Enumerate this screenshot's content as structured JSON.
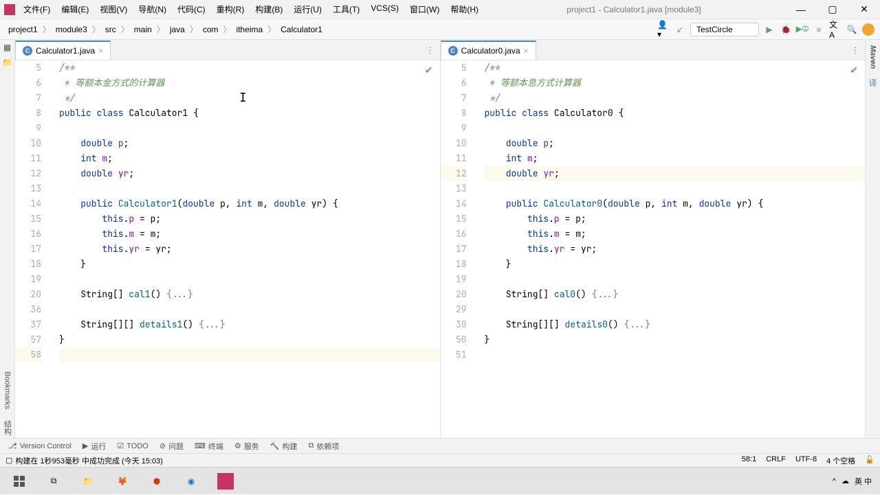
{
  "window": {
    "title": "project1 - Calculator1.java [module3]",
    "controls": {
      "min": "—",
      "max": "▢",
      "close": "✕"
    }
  },
  "menu": [
    "文件(F)",
    "编辑(E)",
    "视图(V)",
    "导航(N)",
    "代码(C)",
    "重构(R)",
    "构建(B)",
    "运行(U)",
    "工具(T)",
    "VCS(S)",
    "窗口(W)",
    "帮助(H)"
  ],
  "breadcrumb": [
    "project1",
    "module3",
    "src",
    "main",
    "java",
    "com",
    "itheima",
    "Calculator1"
  ],
  "run_config": "TestCircle",
  "left_pane": {
    "tab": "Calculator1.java",
    "lines": [
      {
        "n": "5",
        "html": "<span class='comment'>/**</span>"
      },
      {
        "n": "6",
        "html": "<span class='comment'> * </span><span class='comment-zh'>等额本金方式的计算器</span>"
      },
      {
        "n": "7",
        "html": "<span class='comment'> */</span>"
      },
      {
        "n": "8",
        "html": "<span class='kw'>public class</span> Calculator1 {"
      },
      {
        "n": "9",
        "html": ""
      },
      {
        "n": "10",
        "html": "    <span class='kw'>double</span> <span class='field'>p</span>;"
      },
      {
        "n": "11",
        "html": "    <span class='kw'>int</span> <span class='field'>m</span>;"
      },
      {
        "n": "12",
        "html": "    <span class='kw'>double</span> <span class='field'>yr</span>;"
      },
      {
        "n": "13",
        "html": ""
      },
      {
        "n": "14",
        "html": "    <span class='kw'>public</span> <span class='method'>Calculator1</span>(<span class='kw'>double</span> p, <span class='kw'>int</span> m, <span class='kw'>double</span> yr) {"
      },
      {
        "n": "15",
        "html": "        <span class='kw'>this</span>.<span class='field'>p</span> = p;"
      },
      {
        "n": "16",
        "html": "        <span class='kw'>this</span>.<span class='field'>m</span> = m;"
      },
      {
        "n": "17",
        "html": "        <span class='kw'>this</span>.<span class='field'>yr</span> = yr;"
      },
      {
        "n": "18",
        "html": "    }"
      },
      {
        "n": "19",
        "html": ""
      },
      {
        "n": "20",
        "html": "    String[] <span class='method'>cal1</span>() <span class='fold'>{...}</span>"
      },
      {
        "n": "36",
        "html": ""
      },
      {
        "n": "37",
        "html": "    String[][] <span class='method'>details1</span>() <span class='fold'>{...}</span>"
      },
      {
        "n": "57",
        "html": "}"
      },
      {
        "n": "58",
        "html": "",
        "current": true
      }
    ]
  },
  "right_pane": {
    "tab": "Calculator0.java",
    "lines": [
      {
        "n": "5",
        "html": "<span class='comment'>/**</span>"
      },
      {
        "n": "6",
        "html": "<span class='comment'> * </span><span class='comment-zh'>等额本息方式计算器</span>"
      },
      {
        "n": "7",
        "html": "<span class='comment'> */</span>"
      },
      {
        "n": "8",
        "html": "<span class='kw'>public class</span> Calculator0 {"
      },
      {
        "n": "9",
        "html": ""
      },
      {
        "n": "10",
        "html": "    <span class='kw'>double</span> <span class='field'>p</span>;"
      },
      {
        "n": "11",
        "html": "    <span class='kw'>int</span> <span class='field'>m</span>;"
      },
      {
        "n": "12",
        "html": "    <span class='kw'>double</span> <span class='field'>yr</span>;",
        "current": true
      },
      {
        "n": "13",
        "html": ""
      },
      {
        "n": "14",
        "html": "    <span class='kw'>public</span> <span class='method'>Calculator0</span>(<span class='kw'>double</span> p, <span class='kw'>int</span> m, <span class='kw'>double</span> yr) {"
      },
      {
        "n": "15",
        "html": "        <span class='kw'>this</span>.<span class='field'>p</span> = p;"
      },
      {
        "n": "16",
        "html": "        <span class='kw'>this</span>.<span class='field'>m</span> = m;"
      },
      {
        "n": "17",
        "html": "        <span class='kw'>this</span>.<span class='field'>yr</span> = yr;"
      },
      {
        "n": "18",
        "html": "    }"
      },
      {
        "n": "19",
        "html": ""
      },
      {
        "n": "20",
        "html": "    String[] <span class='method'>cal0</span>() <span class='fold'>{...}</span>"
      },
      {
        "n": "29",
        "html": ""
      },
      {
        "n": "30",
        "html": "    String[][] <span class='method'>details0</span>() <span class='fold'>{...}</span>"
      },
      {
        "n": "50",
        "html": "}"
      },
      {
        "n": "51",
        "html": ""
      }
    ]
  },
  "left_strip": [
    "项目",
    "Bookmarks",
    "结构"
  ],
  "right_strip": "Maven",
  "bottom_tabs": [
    "Version Control",
    "运行",
    "TODO",
    "问题",
    "终端",
    "服务",
    "构建",
    "依赖项"
  ],
  "status": {
    "msg": "构建在 1秒953毫秒 中成功完成 (今天 15:03)",
    "pos": "58:1",
    "enc": "CRLF",
    "charset": "UTF-8",
    "indent": "4 个空格"
  },
  "taskbar_time": "英 中"
}
